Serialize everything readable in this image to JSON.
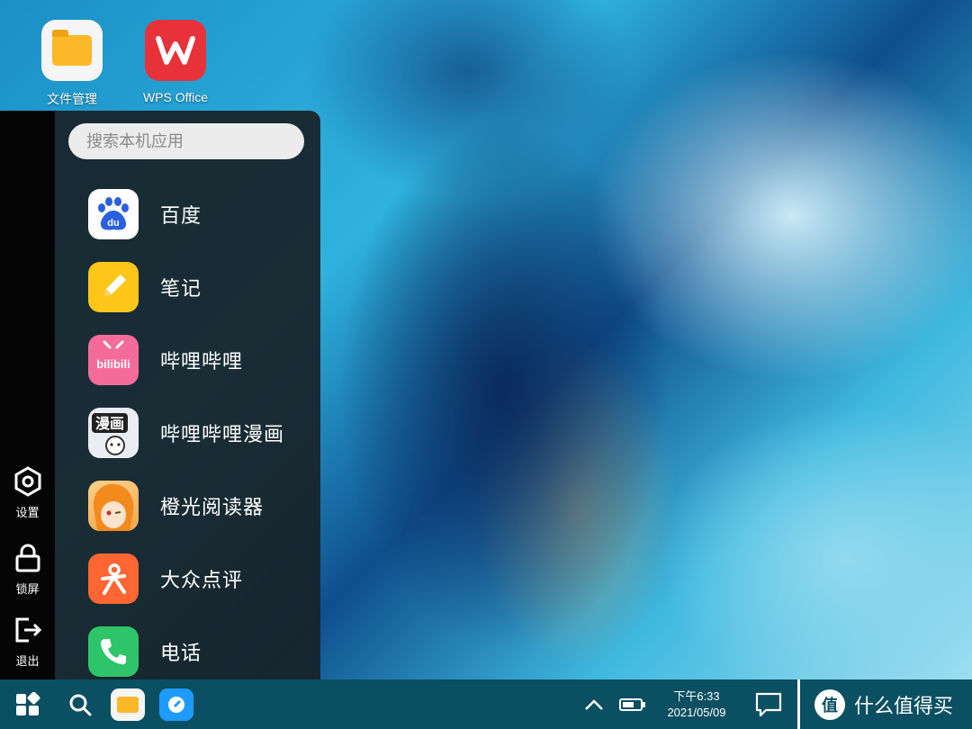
{
  "desktop": {
    "icons": [
      {
        "label": "文件管理"
      },
      {
        "label": "WPS Office"
      }
    ]
  },
  "side_strip": {
    "settings_label": "设置",
    "lock_label": "锁屏",
    "exit_label": "退出"
  },
  "start_menu": {
    "search_placeholder": "搜索本机应用",
    "apps": [
      {
        "label": "百度",
        "icon": "baidu-icon",
        "icon_text": "du"
      },
      {
        "label": "笔记",
        "icon": "notes-icon"
      },
      {
        "label": "哔哩哔哩",
        "icon": "bilibili-icon",
        "icon_text": "bilibili"
      },
      {
        "label": "哔哩哔哩漫画",
        "icon": "bilibili-comics-icon",
        "icon_text": "漫画"
      },
      {
        "label": "橙光阅读器",
        "icon": "orange-reader-icon"
      },
      {
        "label": "大众点评",
        "icon": "dianping-icon"
      },
      {
        "label": "电话",
        "icon": "phone-icon"
      }
    ]
  },
  "taskbar": {
    "time": "下午6:33",
    "date": "2021/05/09",
    "watermark_badge": "值",
    "watermark_text": "什么值得买"
  },
  "colors": {
    "taskbar": "#0b4f62",
    "panel": "#182228",
    "wps_red": "#e8323a",
    "files_yellow": "#fbb829"
  }
}
